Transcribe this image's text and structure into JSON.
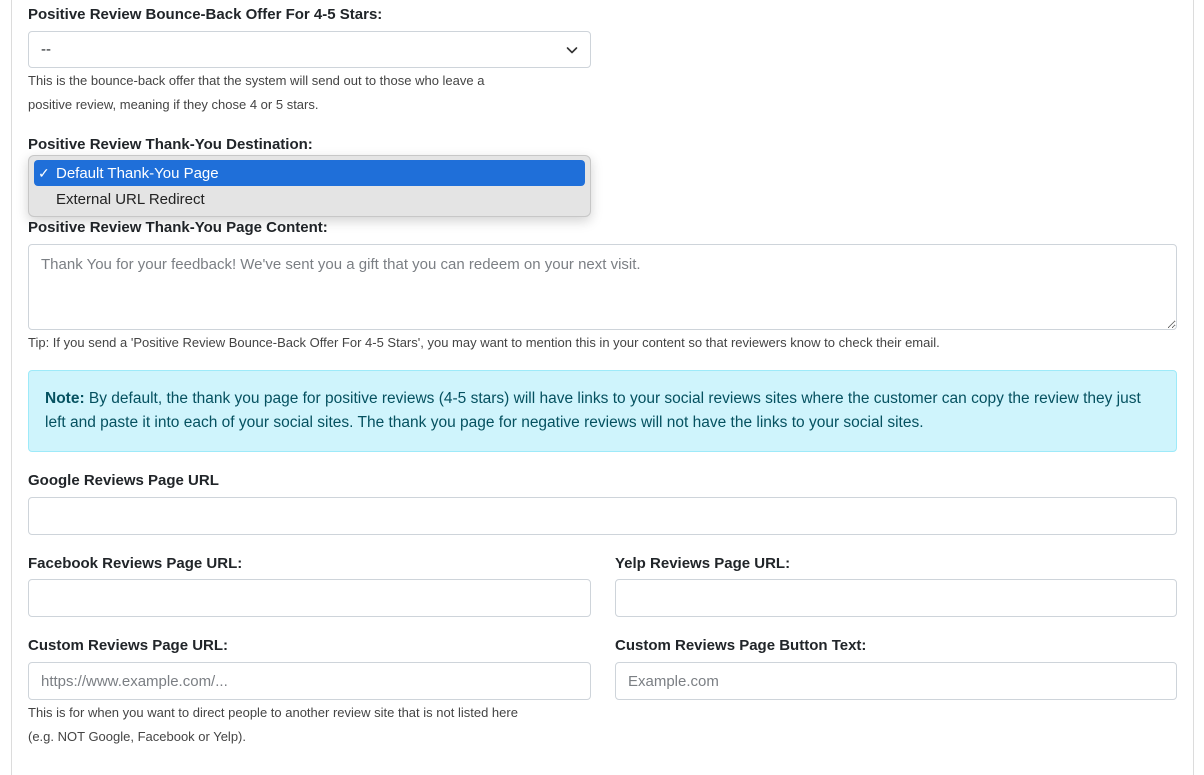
{
  "bounce_back": {
    "label": "Positive Review Bounce-Back Offer For 4-5 Stars:",
    "value": "--",
    "help": "This is the bounce-back offer that the system will send out to those who leave a",
    "help2": "positive review, meaning if they chose 4 or 5 stars."
  },
  "destination": {
    "label": "Positive Review Thank-You Destination:",
    "options": [
      {
        "label": "Default Thank-You Page",
        "selected": true
      },
      {
        "label": "External URL Redirect",
        "selected": false
      }
    ]
  },
  "page_content": {
    "label": "Positive Review Thank-You Page Content:",
    "placeholder": "Thank You for your feedback! We've sent you a gift that you can redeem on your next visit.",
    "tip": "Tip: If you send a 'Positive Review Bounce-Back Offer For 4-5 Stars', you may want to mention this in your content so that reviewers know to check their email."
  },
  "note": {
    "bold": "Note:",
    "text": " By default, the thank you page for positive reviews (4-5 stars) will have links to your social reviews sites where the customer can copy the review they just left and paste it into each of your social sites. The thank you page for negative reviews will not have the links to your social sites."
  },
  "google": {
    "label": "Google Reviews Page URL",
    "value": ""
  },
  "facebook": {
    "label": "Facebook Reviews Page URL:",
    "value": ""
  },
  "yelp": {
    "label": "Yelp Reviews Page URL:",
    "value": ""
  },
  "custom_url": {
    "label": "Custom Reviews Page URL:",
    "placeholder": "https://www.example.com/...",
    "help": "This is for when you want to direct people to another review site that is not listed here",
    "help2": "(e.g. NOT Google, Facebook or Yelp)."
  },
  "custom_button": {
    "label": "Custom Reviews Page Button Text:",
    "placeholder": "Example.com"
  },
  "icons": {
    "dropdown": "chevron-down-icon",
    "selected_option": "checkmark-icon"
  },
  "colors": {
    "selected_option_bg": "#1f6fd9",
    "note_bg": "#cff4fc",
    "note_text": "#055160",
    "border": "#ced4da"
  }
}
